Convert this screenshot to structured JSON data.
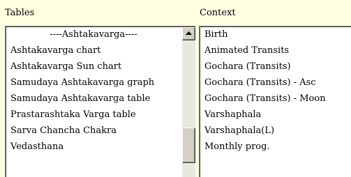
{
  "tables": {
    "label": "Tables",
    "items": [
      "----Ashtakavarga----",
      "Ashtakavarga chart",
      "Ashtakavarga Sun chart",
      "Samudaya Ashtakavarga graph",
      "Samudaya Ashtakavarga table",
      "Prastarashtaka Varga table",
      "Sarva Chancha Chakra",
      "Vedasthana",
      ""
    ]
  },
  "context": {
    "label": "Context",
    "items": [
      "Birth",
      "Animated Transits",
      "Gochara (Transits)",
      "Gochara (Transits) - Asc",
      "Gochara (Transits) - Moon",
      "Varshaphala",
      "Varshaphala(L)",
      "Monthly prog.",
      ""
    ]
  },
  "icons": {
    "scroll_up": "triangle-up-icon"
  }
}
